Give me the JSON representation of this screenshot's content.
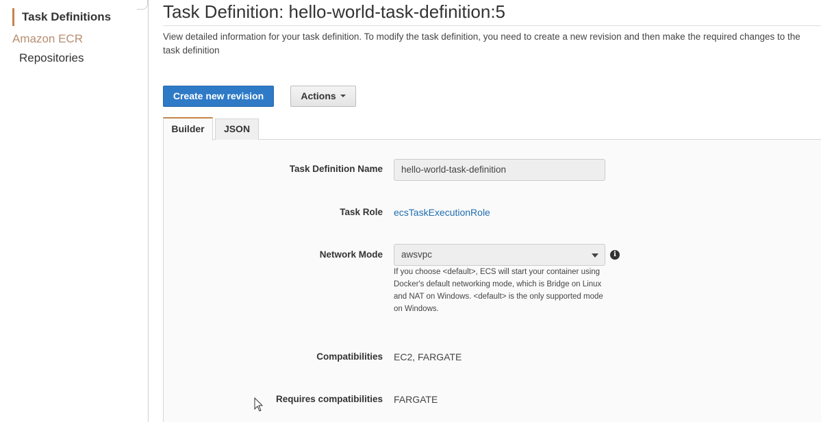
{
  "sidebar": {
    "active_item": "Task Definitions",
    "group_title": "Amazon ECR",
    "group_item": "Repositories"
  },
  "page": {
    "title": "Task Definition: hello-world-task-definition:5",
    "description": "View detailed information for your task definition. To modify the task definition, you need to create a new revision and then make the required changes to the task definition"
  },
  "toolbar": {
    "create_revision_label": "Create new revision",
    "actions_label": "Actions"
  },
  "tabs": [
    {
      "label": "Builder",
      "active": true
    },
    {
      "label": "JSON",
      "active": false
    }
  ],
  "form": {
    "task_definition_name": {
      "label": "Task Definition Name",
      "value": "hello-world-task-definition"
    },
    "task_role": {
      "label": "Task Role",
      "value": "ecsTaskExecutionRole"
    },
    "network_mode": {
      "label": "Network Mode",
      "value": "awsvpc",
      "help": "If you choose <default>, ECS will start your container using Docker's default networking mode, which is Bridge on Linux and NAT on Windows. <default> is the only supported mode on Windows."
    },
    "compatibilities": {
      "label": "Compatibilities",
      "value": "EC2, FARGATE"
    },
    "requires_compatibilities": {
      "label": "Requires compatibilities",
      "value": "FARGATE"
    }
  },
  "icons": {
    "info": "info-icon",
    "cursor": "mouse-pointer-icon"
  },
  "colors": {
    "primary_button": "#2e7ac6",
    "active_accent": "#c7834d",
    "link": "#1f6db0"
  }
}
